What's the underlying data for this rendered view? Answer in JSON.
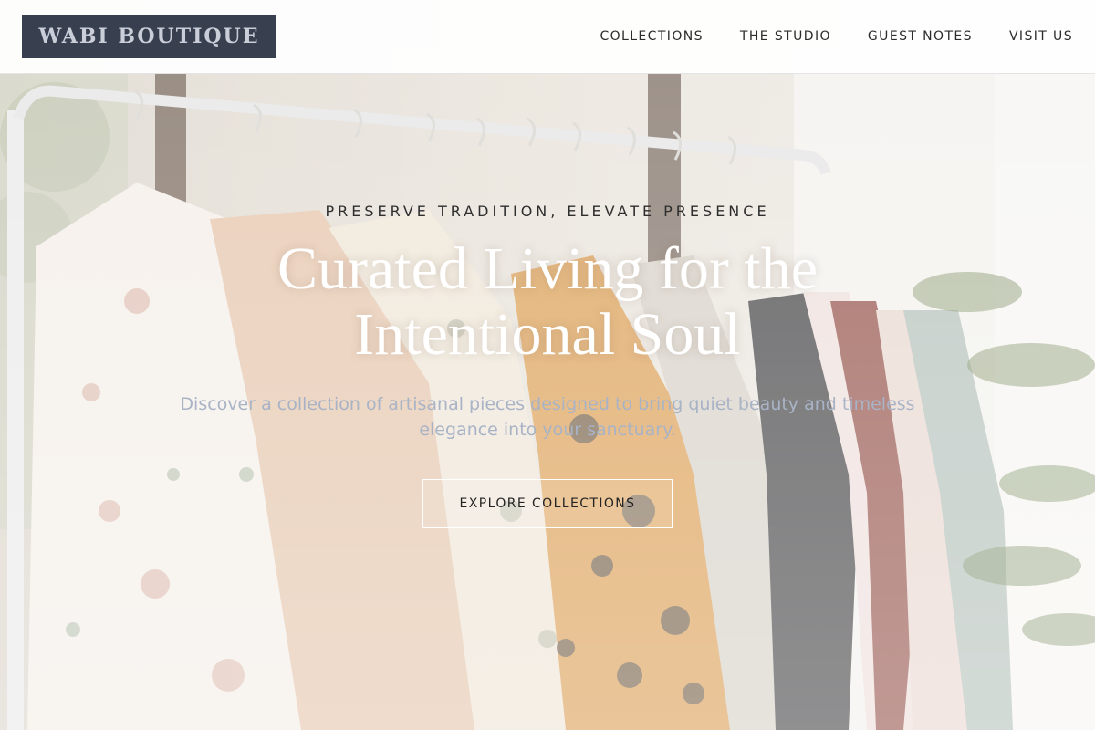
{
  "header": {
    "logo_text": "WABI BOUTIQUE",
    "nav": [
      {
        "label": "COLLECTIONS"
      },
      {
        "label": "THE STUDIO"
      },
      {
        "label": "GUEST NOTES"
      },
      {
        "label": "VISIT US"
      }
    ]
  },
  "hero": {
    "eyebrow": "PRESERVE TRADITION, ELEVATE PRESENCE",
    "title": "Curated Living for the Intentional Soul",
    "subtitle": "Discover a collection of artisanal pieces designed to bring quiet beauty and timeless elegance into your sanctuary.",
    "cta_label": "EXPLORE COLLECTIONS",
    "background_image": "clothing-rack-photo"
  },
  "colors": {
    "logo_background": "#384050",
    "logo_text": "#c9ced8",
    "nav_text": "#2c2c2c",
    "title_text": "#ffffff",
    "subtitle_text": "#a9b3c6"
  }
}
